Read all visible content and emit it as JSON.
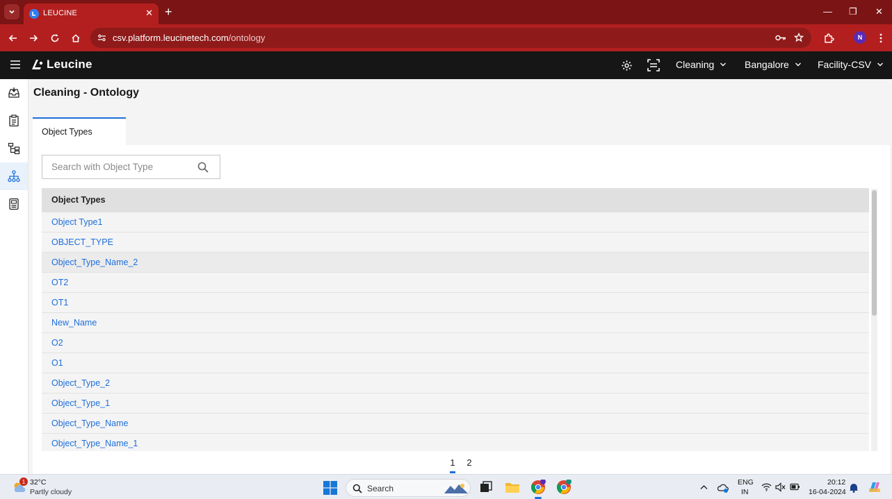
{
  "browser": {
    "tab_title": "LEUCINE",
    "url_host": "csv.platform.leucinetech.com",
    "url_path": "/ontology",
    "profile_initial": "N"
  },
  "app": {
    "brand": "Leucine",
    "use_case": "Cleaning",
    "location": "Bangalore",
    "facility": "Facility-CSV"
  },
  "page": {
    "title": "Cleaning - Ontology",
    "tabs": [
      {
        "label": "Object Types"
      }
    ],
    "search": {
      "placeholder": "Search with Object Type",
      "value": ""
    },
    "table": {
      "header": "Object Types",
      "rows": [
        "Object Type1",
        "OBJECT_TYPE",
        "Object_Type_Name_2",
        "OT2",
        "OT1",
        "New_Name",
        "O2",
        "O1",
        "Object_Type_2",
        "Object_Type_1",
        "Object_Type_Name",
        "Object_Type_Name_1"
      ]
    },
    "pagination": {
      "pages": [
        "1",
        "2"
      ],
      "current": "1"
    }
  },
  "taskbar": {
    "weather_badge": "1",
    "temperature": "32°C",
    "condition": "Partly cloudy",
    "search_label": "Search",
    "lang_top": "ENG",
    "lang_bottom": "IN",
    "time": "20:12",
    "date": "16-04-2024"
  },
  "colors": {
    "browser_frame": "#7b1414",
    "browser_toolbar": "#b31f1f",
    "app_header": "#161616",
    "link": "#1d6fdc",
    "active_indicator": "#1d6fdc"
  }
}
